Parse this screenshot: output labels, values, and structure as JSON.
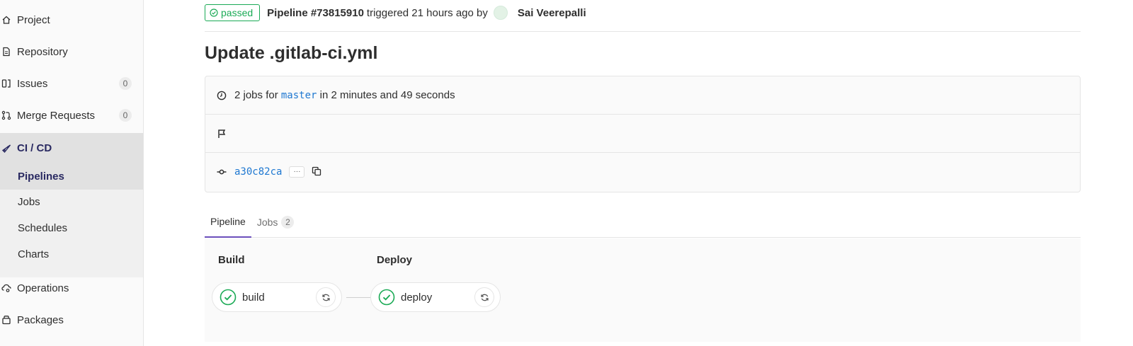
{
  "sidebar": {
    "items": [
      {
        "label": "Project"
      },
      {
        "label": "Repository"
      },
      {
        "label": "Issues",
        "count": "0"
      },
      {
        "label": "Merge Requests",
        "count": "0"
      },
      {
        "label": "CI / CD"
      },
      {
        "label": "Operations"
      },
      {
        "label": "Packages"
      }
    ],
    "cicd_sub": [
      {
        "label": "Pipelines"
      },
      {
        "label": "Jobs"
      },
      {
        "label": "Schedules"
      },
      {
        "label": "Charts"
      }
    ]
  },
  "header": {
    "status": "passed",
    "pipeline_id": "Pipeline #73815910",
    "trigger_text": "triggered 21 hours ago by",
    "author": "Sai Veerepalli"
  },
  "commit_title": "Update .gitlab-ci.yml",
  "info": {
    "jobs_prefix": "2 jobs for",
    "branch": "master",
    "jobs_suffix": "in 2 minutes and 49 seconds",
    "commit_sha": "a30c82ca",
    "ellipsis": "···"
  },
  "tabs": {
    "pipeline": "Pipeline",
    "jobs": "Jobs",
    "jobs_count": "2"
  },
  "stages": [
    {
      "title": "Build",
      "job": "build"
    },
    {
      "title": "Deploy",
      "job": "deploy"
    }
  ],
  "colors": {
    "success": "#1aaa55",
    "link": "#1f78d1",
    "active_tab": "#6b4fbb",
    "nav_active": "#292961"
  }
}
